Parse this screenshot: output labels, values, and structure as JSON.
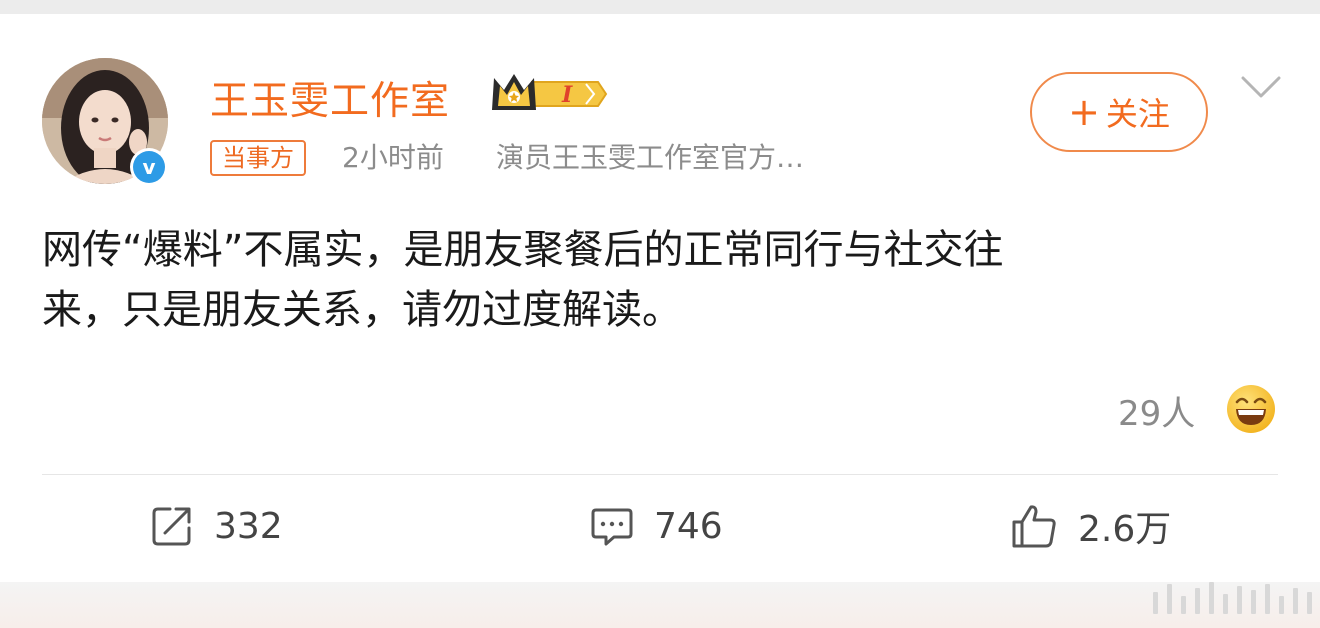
{
  "post": {
    "user_name": "王玉雯工作室",
    "member_level": "I",
    "official_tag": "当事方",
    "time": "2小时前",
    "source": "演员王玉雯工作室官方…",
    "follow_label": "关注",
    "text_line1": "网传“爆料”不属实，是朋友聚餐后的正常同行与社交往",
    "text_line2": "来，只是朋友关系，请勿过度解读。",
    "reaction_count": "29人"
  },
  "actions": {
    "repost_count": "332",
    "comment_count": "746",
    "like_count": "2.6万"
  },
  "icons": {
    "verified": "verified-icon",
    "member": "crown-member-badge",
    "more": "chevron-down-icon",
    "emoji": "laugh-emoji-icon",
    "repost": "repost-icon",
    "comment": "comment-icon",
    "like": "thumbs-up-icon"
  },
  "colors": {
    "accent": "#f26b1f",
    "verified": "#2d9be6",
    "muted": "#8c8c8c"
  }
}
